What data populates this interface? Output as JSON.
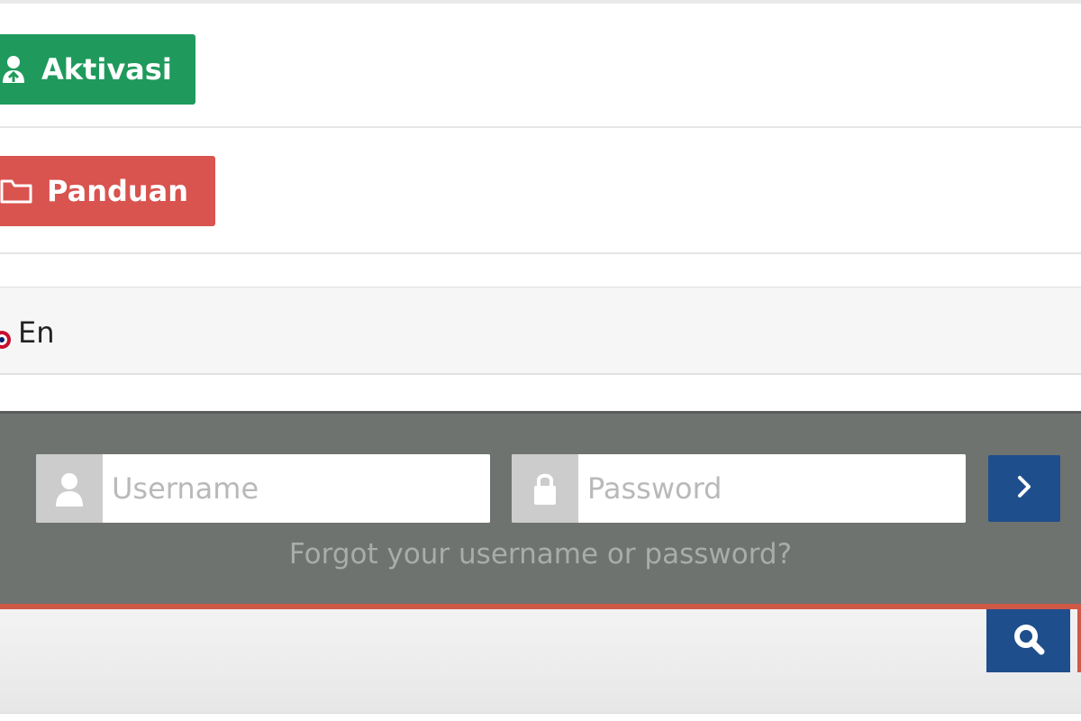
{
  "menu": {
    "aktivasi_label": "Aktivasi",
    "panduan_label": "Panduan"
  },
  "language": {
    "label": "En",
    "icon": "flag-icon"
  },
  "login": {
    "username_placeholder": "Username",
    "password_placeholder": "Password",
    "username_icon": "user-icon",
    "password_icon": "lock-icon",
    "submit_icon": "chevron-right-icon",
    "forgot_text": "Forgot your username or password?"
  },
  "search": {
    "icon": "search-icon"
  },
  "colors": {
    "aktivasi": "#1f9a5c",
    "panduan": "#d9534f",
    "login_bar": "#6f7370",
    "primary_blue": "#1f4e8c",
    "accent_red": "#cf5846"
  }
}
